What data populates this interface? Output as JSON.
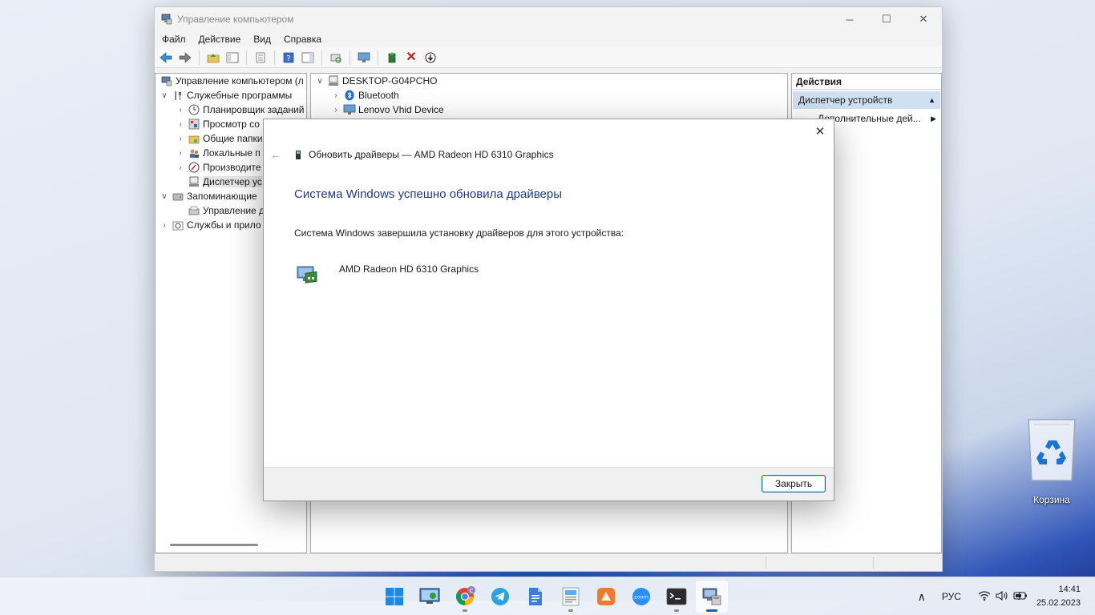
{
  "colors": {
    "accent": "#0067c0",
    "dialog_title": "#1f3d80",
    "actions_section_bg": "#cfe0f2",
    "close_icon_red": "#d11a1a"
  },
  "window": {
    "title": "Управление компьютером",
    "controls": {
      "minimize": "─",
      "maximize": "☐",
      "close": "✕"
    }
  },
  "menu": [
    "Файл",
    "Действие",
    "Вид",
    "Справка"
  ],
  "toolbar": {
    "icons": [
      "back-arrow-icon",
      "forward-arrow-icon",
      "folder-up-icon",
      "console-tree-icon",
      "properties-icon",
      "help-icon",
      "show-hide-icon",
      "scan-hardware-icon",
      "monitor-icon",
      "update-driver-icon",
      "uninstall-icon",
      "disable-device-icon"
    ]
  },
  "tree": {
    "items": [
      {
        "label": "Управление компьютером (л",
        "icon": "computer-management-icon",
        "chev": "",
        "indent": 0
      },
      {
        "label": "Служебные программы",
        "icon": "tools-icon",
        "chev": "∨",
        "indent": 1
      },
      {
        "label": "Планировщик заданий",
        "icon": "clock-icon",
        "chev": "›",
        "indent": 2
      },
      {
        "label": "Просмотр со",
        "icon": "event-viewer-icon",
        "chev": "›",
        "indent": 2
      },
      {
        "label": "Общие папки",
        "icon": "shared-folder-icon",
        "chev": "›",
        "indent": 2
      },
      {
        "label": "Локальные п",
        "icon": "users-icon",
        "chev": "›",
        "indent": 2
      },
      {
        "label": "Производите",
        "icon": "performance-icon",
        "chev": "›",
        "indent": 2
      },
      {
        "label": "Диспетчер ус",
        "icon": "device-manager-icon",
        "chev": "",
        "indent": 2,
        "selected": true
      },
      {
        "label": "Запоминающие",
        "icon": "storage-icon",
        "chev": "∨",
        "indent": 1
      },
      {
        "label": "Управление д",
        "icon": "disk-management-icon",
        "chev": "",
        "indent": 2
      },
      {
        "label": "Службы и прило",
        "icon": "services-icon",
        "chev": "›",
        "indent": 1
      }
    ]
  },
  "devices": {
    "root": "DESKTOP-G04PCHO",
    "items": [
      {
        "label": "Bluetooth",
        "icon": "bluetooth-icon"
      },
      {
        "label": "Lenovo Vhid Device",
        "icon": "monitor-device-icon"
      }
    ]
  },
  "actions": {
    "header": "Действия",
    "section": "Диспетчер устройств",
    "item": "Дополнительные дей..."
  },
  "dialog": {
    "header": "Обновить драйверы — AMD Radeon HD 6310 Graphics",
    "title": "Система Windows успешно обновила драйверы",
    "message": "Система Windows завершила установку драйверов для этого устройства:",
    "device_name": "AMD Radeon HD 6310 Graphics",
    "close_button": "Закрыть"
  },
  "desktop": {
    "recycle_bin_label": "Корзина"
  },
  "taskbar": {
    "apps": [
      {
        "name": "start-button",
        "icon": "windows-logo-icon",
        "active": false,
        "running": false
      },
      {
        "name": "taskbar-app-remote-desktop",
        "icon": "remote-desktop-icon",
        "active": false,
        "running": false
      },
      {
        "name": "taskbar-app-chrome",
        "icon": "chrome-icon",
        "active": false,
        "running": true,
        "badge": "C"
      },
      {
        "name": "taskbar-app-telegram",
        "icon": "telegram-icon",
        "active": false,
        "running": false
      },
      {
        "name": "taskbar-app-docs",
        "icon": "document-icon",
        "active": false,
        "running": false
      },
      {
        "name": "taskbar-app-editor",
        "icon": "editor-icon",
        "active": false,
        "running": true
      },
      {
        "name": "taskbar-app-orange",
        "icon": "orange-app-icon",
        "active": false,
        "running": false
      },
      {
        "name": "taskbar-app-zoom",
        "icon": "zoom-icon",
        "active": false,
        "running": false,
        "text": "zoom"
      },
      {
        "name": "taskbar-app-terminal",
        "icon": "terminal-icon",
        "active": false,
        "running": true
      },
      {
        "name": "taskbar-app-computer-management",
        "icon": "computer-management-icon",
        "active": true,
        "running": true
      }
    ],
    "tray": {
      "chevron": "∧",
      "language": "РУС",
      "time": "14:41",
      "date": "25.02.2023"
    }
  }
}
